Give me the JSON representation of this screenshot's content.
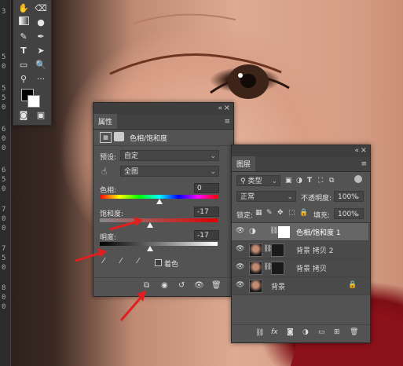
{
  "ruler": {
    "marks": [
      "3",
      "5",
      "0",
      "5",
      "5",
      "0",
      "6",
      "0",
      "0",
      "6",
      "5",
      "0",
      "7",
      "0",
      "0",
      "7",
      "5",
      "0",
      "8",
      "0",
      "0"
    ]
  },
  "toolbar": {
    "tools": [
      "hand-icon",
      "eraser-icon",
      "gradient-icon",
      "drop-icon",
      "brush-icon",
      "pen-icon",
      "type-icon",
      "path-select-icon",
      "rectangle-icon",
      "zoom-icon",
      "more-icon"
    ],
    "type_glyph": "T",
    "more_glyph": "···"
  },
  "properties": {
    "tab": "属性",
    "header": "色相/饱和度",
    "preset_label": "预设:",
    "preset_value": "自定",
    "channel_value": "全图",
    "hue_label": "色相:",
    "hue_value": "0",
    "sat_label": "饱和度:",
    "sat_value": "-17",
    "light_label": "明度:",
    "light_value": "-17",
    "colorize_label": "着色",
    "collapse": "«",
    "close": "×",
    "menu": "≡"
  },
  "layers": {
    "tab": "图层",
    "filter_kind": "类型",
    "blend_mode": "正常",
    "opacity_label": "不透明度:",
    "opacity_value": "100%",
    "lock_label": "锁定:",
    "fill_label": "填充:",
    "fill_value": "100%",
    "collapse": "«",
    "close": "×",
    "menu": "≡",
    "items": [
      {
        "name": "色相/饱和度 1"
      },
      {
        "name": "背景 拷贝 2"
      },
      {
        "name": "背景 拷贝"
      },
      {
        "name": "背景"
      }
    ],
    "footer_fx": "fx"
  }
}
